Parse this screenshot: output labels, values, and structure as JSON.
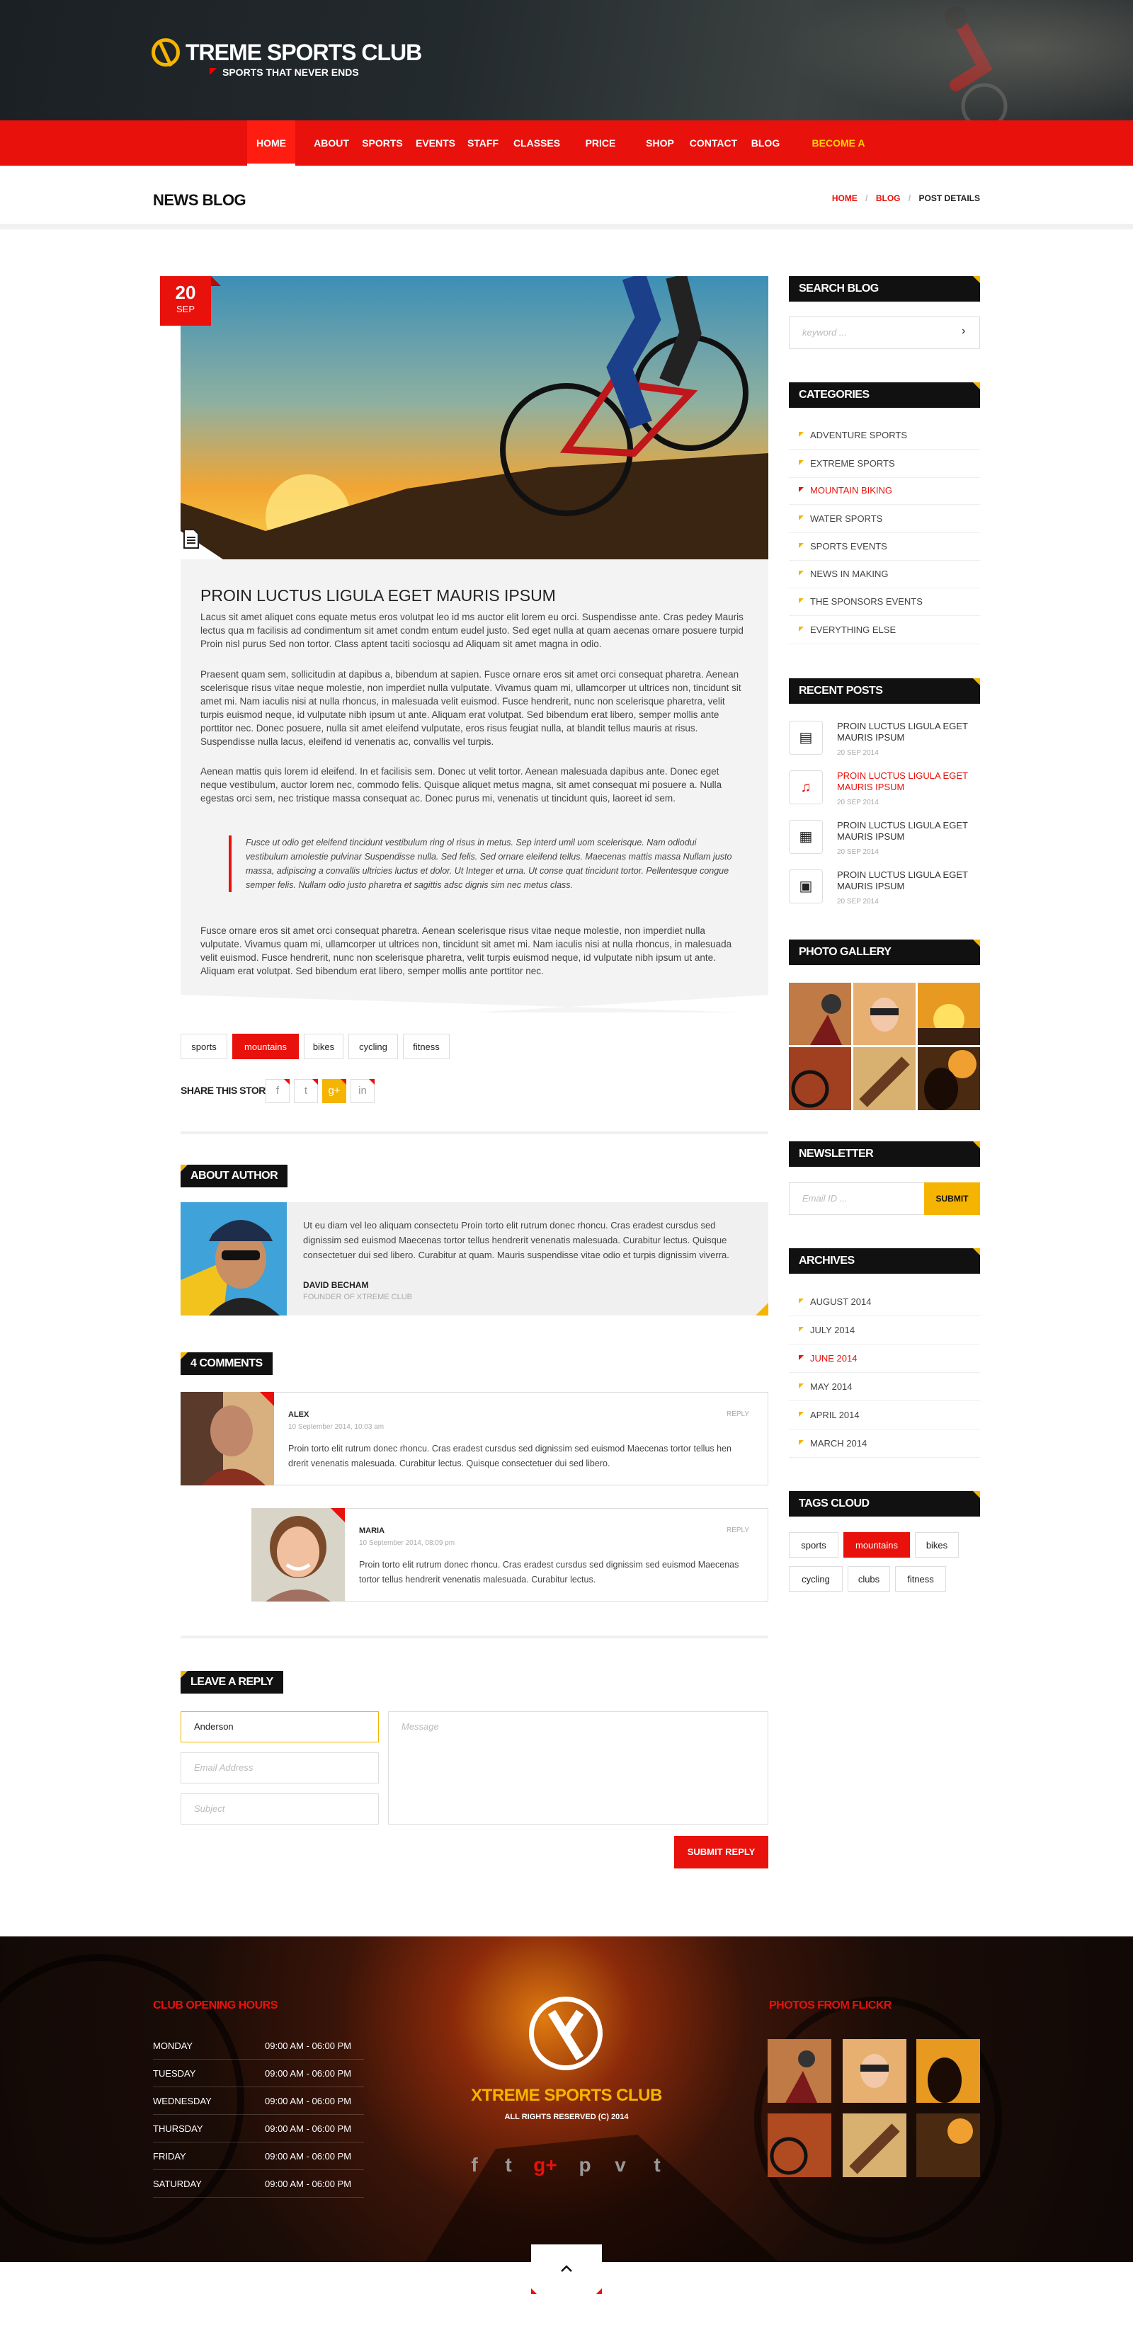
{
  "brand": {
    "title": "TREME SPORTS CLUB",
    "tagline": "SPORTS THAT NEVER ENDS"
  },
  "nav": [
    {
      "label": "HOME",
      "active": true
    },
    {
      "label": "ABOUT"
    },
    {
      "label": "SPORTS"
    },
    {
      "label": "EVENTS"
    },
    {
      "label": "STAFF"
    },
    {
      "label": "CLASSES"
    },
    {
      "label": "PRICE PLANS"
    },
    {
      "label": "SHOP"
    },
    {
      "label": "CONTACT"
    },
    {
      "label": "BLOG"
    },
    {
      "label": "BECOME A MEMBER"
    }
  ],
  "page_title": "NEWS BLOG",
  "breadcrumb": [
    "HOME",
    "/",
    "BLOG",
    "/",
    "POST DETAILS"
  ],
  "post": {
    "day": "20",
    "month": "SEP",
    "title": "PROIN LUCTUS LIGULA EGET MAURIS IPSUM",
    "para1": "Lacus sit amet aliquet cons equate metus eros volutpat leo id ms auctor elit lorem eu orci. Suspendisse ante. Cras pedey Mauris lectus qua m facilisis ad condimentum sit amet condm entum eudel justo. Sed eget nulla at quam aecenas ornare posuere turpid Proin nisl purus Sed non tortor. Class aptent taciti sociosqu ad Aliquam sit amet magna in odio.",
    "para2": "Praesent quam sem, sollicitudin at dapibus a, bibendum at sapien. Fusce ornare eros sit amet orci consequat pharetra. Aenean scelerisque risus vitae neque molestie, non imperdiet nulla vulputate. Vivamus quam mi, ullamcorper ut ultrices non, tincidunt sit amet mi. Nam iaculis nisi at nulla rhoncus, in malesuada velit euismod. Fusce hendrerit, nunc non scelerisque pharetra, velit turpis euismod neque, id vulputate nibh ipsum ut ante. Aliquam erat volutpat. Sed bibendum erat libero, semper mollis ante porttitor nec. Donec posuere, nulla sit amet eleifend vulputate, eros risus feugiat nulla, at blandit tellus mauris at risus. Suspendisse nulla lacus, eleifend id venenatis ac, convallis vel turpis.",
    "para3": "Aenean mattis quis lorem id eleifend. In et facilisis sem. Donec ut velit tortor. Aenean malesuada dapibus ante. Donec eget neque vestibulum, auctor lorem nec, commodo felis. Quisque aliquet metus magna, sit amet consequat mi posuere a. Nulla egestas orci sem, nec tristique massa consequat ac. Donec purus mi, venenatis ut tincidunt quis, laoreet id sem.",
    "quote": "Fusce ut odio get eleifend tincidunt vestibulum ring ol risus in metus. Sep interd umil uom scelerisque. Nam odiodui vestibulum amolestie pulvinar Suspendisse nulla. Sed felis. Sed ornare eleifend tellus. Maecenas mattis massa Nullam justo massa, adipiscing a convallis ultricies luctus et dolor. Ut Integer et urna. Ut conse quat tincidunt tortor. Pellentesque congue semper felis. Nullam odio justo pharetra et sagittis adsc dignis sim nec metus class.",
    "para4": "Fusce ornare eros sit amet orci consequat pharetra. Aenean scelerisque risus vitae neque molestie, non imperdiet nulla vulputate. Vivamus quam mi, ullamcorper ut ultrices non, tincidunt sit amet mi. Nam iaculis nisi at nulla rhoncus, in malesuada velit euismod. Fusce hendrerit, nunc non scelerisque pharetra, velit turpis euismod neque, id vulputate nibh ipsum ut ante. Aliquam erat volutpat. Sed bibendum erat libero, semper mollis ante porttitor nec."
  },
  "post_tags": [
    "sports",
    "mountains",
    "bikes",
    "cycling",
    "fitness"
  ],
  "share_label": "SHARE THIS STORY",
  "share_buttons": [
    "f",
    "t",
    "g+",
    "in"
  ],
  "about_author": {
    "heading": "ABOUT AUTHOR",
    "bio": "Ut eu diam vel leo aliquam consectetu Proin torto elit rutrum donec rhoncu. Cras eradest cursdus sed dignissim sed euismod Maecenas tortor tellus hendrerit venenatis malesuada. Curabitur lectus. Quisque consectetuer dui sed libero. Curabitur at quam. Mauris suspendisse vitae odio et turpis dignissim viverra.",
    "name": "DAVID BECHAM",
    "role": "FOUNDER OF XTREME CLUB"
  },
  "comments": {
    "heading": "4 COMMENTS",
    "items": [
      {
        "name": "ALEX",
        "date": "10 September 2014, 10:03 am",
        "reply": "REPLY",
        "text": "Proin torto elit rutrum donec rhoncu. Cras eradest cursdus sed dignissim sed euismod Maecenas tortor tellus hen drerit venenatis malesuada. Curabitur lectus. Quisque consectetuer dui sed libero."
      },
      {
        "name": "MARIA",
        "date": "10 September 2014, 08:09 pm",
        "reply": "REPLY",
        "text": "Proin torto elit rutrum donec rhoncu. Cras eradest cursdus sed dignissim sed euismod Maecenas tortor tellus hendrerit venenatis malesuada. Curabitur lectus."
      }
    ]
  },
  "reply_form": {
    "heading": "LEAVE A REPLY",
    "name_value": "Anderson",
    "email_placeholder": "Email Address",
    "subject_placeholder": "Subject",
    "message_placeholder": "Message",
    "submit": "SUBMIT REPLY"
  },
  "sidebar": {
    "search": {
      "heading": "SEARCH BLOG",
      "placeholder": "keyword ..."
    },
    "categories": {
      "heading": "CATEGORIES",
      "items": [
        "ADVENTURE SPORTS",
        "EXTREME SPORTS",
        "MOUNTAIN BIKING",
        "WATER SPORTS",
        "SPORTS EVENTS",
        "NEWS IN MAKING",
        "THE SPONSORS EVENTS",
        "EVERYTHING ELSE"
      ]
    },
    "recent": {
      "heading": "RECENT POSTS",
      "items": [
        {
          "title": "PROIN LUCTUS LIGULA EGET MAURIS IPSUM",
          "date": "20 SEP 2014",
          "icon": "document-icon"
        },
        {
          "title": "PROIN LUCTUS LIGULA EGET MAURIS IPSUM",
          "date": "20 SEP 2014",
          "icon": "music-icon"
        },
        {
          "title": "PROIN LUCTUS LIGULA EGET MAURIS IPSUM",
          "date": "20 SEP 2014",
          "icon": "film-icon"
        },
        {
          "title": "PROIN LUCTUS LIGULA EGET MAURIS IPSUM",
          "date": "20 SEP 2014",
          "icon": "image-icon"
        }
      ]
    },
    "gallery_heading": "PHOTO GALLERY",
    "newsletter": {
      "heading": "NEWSLETTER",
      "placeholder": "Email ID ...",
      "button": "SUBMIT"
    },
    "archives": {
      "heading": "ARCHIVES",
      "items": [
        "AUGUST 2014",
        "JULY 2014",
        "JUNE 2014",
        "MAY 2014",
        "APRIL 2014",
        "MARCH 2014"
      ]
    },
    "tags": {
      "heading": "TAGS CLOUD",
      "items": [
        "sports",
        "mountains",
        "bikes",
        "cycling",
        "clubs",
        "fitness"
      ]
    }
  },
  "footer": {
    "hours_heading": "CLUB OPENING HOURS",
    "hours": [
      {
        "day": "MONDAY",
        "time": "09:00 AM - 06:00 PM"
      },
      {
        "day": "TUESDAY",
        "time": "09:00 AM - 06:00 PM"
      },
      {
        "day": "WEDNESDAY",
        "time": "09:00 AM - 06:00 PM"
      },
      {
        "day": "THURSDAY",
        "time": "09:00 AM - 06:00 PM"
      },
      {
        "day": "FRIDAY",
        "time": "09:00 AM - 06:00 PM"
      },
      {
        "day": "SATURDAY",
        "time": "09:00 AM - 06:00 PM"
      }
    ],
    "club_name": "XTREME SPORTS CLUB",
    "copyright": "ALL RIGHTS RESERVED (C) 2014",
    "social": [
      "f",
      "t",
      "g+",
      "p",
      "v",
      "t"
    ],
    "flickr_heading": "PHOTOS FROM FLICKR"
  },
  "colors": {
    "accent_red": "#e8110c",
    "accent_yellow": "#f5b400",
    "dark": "#111111"
  }
}
